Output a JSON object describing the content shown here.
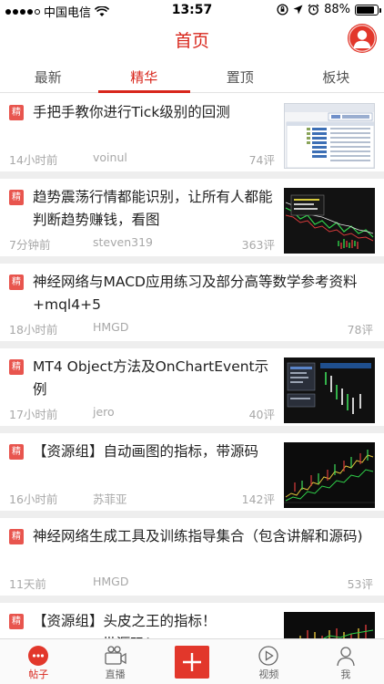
{
  "status_bar": {
    "carrier": "中国电信",
    "time": "13:57",
    "battery": "88%",
    "battery_level": 0.88
  },
  "header": {
    "title": "首页"
  },
  "tabs": [
    {
      "label": "最新"
    },
    {
      "label": "精华"
    },
    {
      "label": "置顶"
    },
    {
      "label": "板块"
    }
  ],
  "posts": [
    {
      "badge": "精",
      "title": "手把手教你进行Tick级别的回测",
      "time": "14小时前",
      "author": "voinul",
      "comments": "74评"
    },
    {
      "badge": "精",
      "title": "趋势震荡行情都能识别，让所有人都能判断趋势赚钱，看图",
      "time": "7分钟前",
      "author": "steven319",
      "comments": "363评"
    },
    {
      "badge": "精",
      "title": "神经网络与MACD应用练习及部分高等数学参考资料+mql4+5",
      "time": "18小时前",
      "author": "HMGD",
      "comments": "78评"
    },
    {
      "badge": "精",
      "title": "MT4 Object方法及OnChartEvent示例",
      "time": "17小时前",
      "author": "jero",
      "comments": "40评"
    },
    {
      "badge": "精",
      "title": "【资源组】自动画图的指标，带源码",
      "time": "16小时前",
      "author": "苏菲亚",
      "comments": "142评"
    },
    {
      "badge": "精",
      "title": "神经网络生成工具及训练指导集合（包含讲解和源码)",
      "time": "11天前",
      "author": "HMGD",
      "comments": "53评"
    },
    {
      "badge": "精",
      "title": "【资源组】头皮之王的指标！KINGBIRD带源码！"
    }
  ],
  "tabbar": [
    {
      "label": "帖子",
      "icon": "chat-bubble-icon"
    },
    {
      "label": "直播",
      "icon": "video-camera-icon"
    },
    {
      "label": "",
      "icon": "plus-icon"
    },
    {
      "label": "视频",
      "icon": "play-circle-icon"
    },
    {
      "label": "我",
      "icon": "person-icon"
    }
  ],
  "colors": {
    "accent": "#d8261c",
    "badge": "#e8554e",
    "separator": "#eeeeee"
  }
}
